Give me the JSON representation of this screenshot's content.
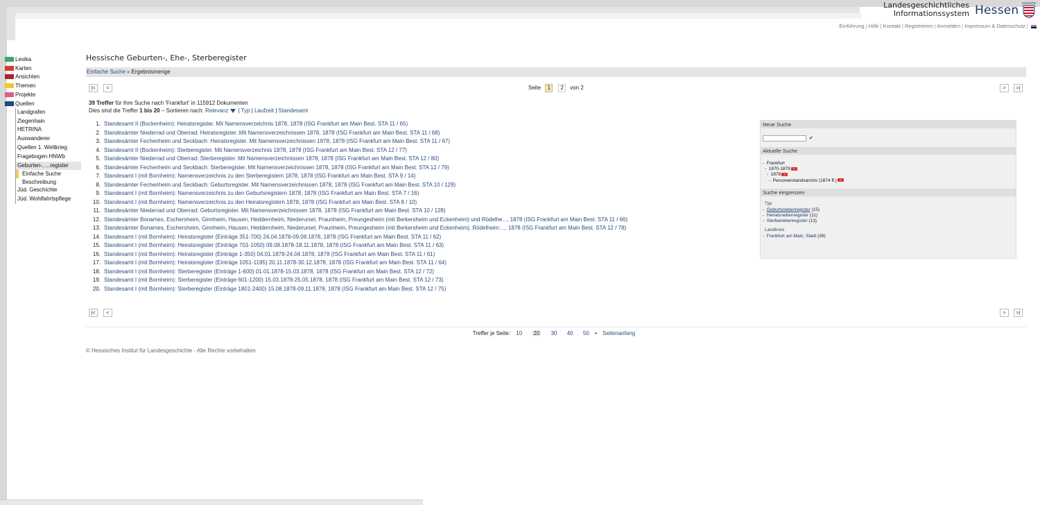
{
  "logo": {
    "line1": "Landesgeschichtliches",
    "line2": "Informationssystem",
    "brand": "Hessen",
    "crest_label": "HESSEN"
  },
  "topnav": [
    "Einführung",
    "Hilfe",
    "Kontakt",
    "Registrieren",
    "Anmelden",
    "Impressum & Datenschutz"
  ],
  "sidebar": {
    "main": [
      {
        "label": "Lexika",
        "color": "#3fa56a"
      },
      {
        "label": "Karten",
        "color": "#d83a2e"
      },
      {
        "label": "Ansichten",
        "color": "#a5282f"
      },
      {
        "label": "Themen",
        "color": "#f2c630"
      },
      {
        "label": "Projekte",
        "color": "#d8608a"
      },
      {
        "label": "Quellen",
        "color": "#1f4a7a"
      }
    ],
    "sub": [
      "Landgrafen",
      "Ziegenhain",
      "HETRINA",
      "Auswanderer",
      "Quellen 1. Weltkrieg",
      "Fragebogen HNWb",
      "Geburten-, ...register",
      "Jüd. Geschichte",
      "Jüd. Wohlfahrtspflege"
    ],
    "subsub": [
      "Einfache Suche",
      "Beschreibung"
    ]
  },
  "page_title": "Hessische Geburten-, Ehe-, Sterberegister",
  "breadcrumb": {
    "link": "Einfache Suche",
    "sep": "»",
    "current": "Ergebnismenge"
  },
  "pager": {
    "first": "|<",
    "prev": "<",
    "next": ">",
    "last": ">|",
    "label": "Seite",
    "pages": [
      "1",
      "2"
    ],
    "of": "von 2"
  },
  "summary": {
    "count": "39 Treffer",
    "text1": "für Ihre Suche nach 'Frankfurt' in 115912 Dokumenten",
    "text2a": "Dies sind die Treffer",
    "range": "1 bis 20",
    "text2b": "– Sortieren nach:",
    "sort": [
      "Relevanz",
      "Typ",
      "Laufzeit",
      "Standesamt"
    ]
  },
  "results": [
    "Standesamt II (Bockenheim): Heiratsregister. Mit Namensverzeichnis 1878, 1878 (ISG Frankfurt am Main Best. STA 11 / 65)",
    "Standesämter Niederrad und Oberrad: Heiratsregister. Mit Namensverzeichnissen 1878, 1878 (ISG Frankfurt am Main Best. STA 11 / 68)",
    "Standesämter Fechenheim und Seckbach: Heiratsregister. Mit Namensverzeichnissen 1878, 1878 (ISG Frankfurt am Main Best. STA 11 / 67)",
    "Standesamt II (Bockenheim): Sterberegister. Mit Namensverzeichnis 1878, 1878 (ISG Frankfurt am Main Best. STA 12 / 77)",
    "Standesämter Niederrad und Oberrad: Sterberegister. Mit Namensverzeichnissen 1878, 1878 (ISG Frankfurt am Main Best. STA 12 / 80)",
    "Standesämter Fechenheim und Seckbach: Sterberegister. Mit Namensverzeichnissen 1878, 1878 (ISG Frankfurt am Main Best. STA 12 / 79)",
    "Standesamt I (mit Bornheim): Namensverzeichnis zu den Sterberegistern 1878, 1878 (ISG Frankfurt am Main Best. STA 9 / 14)",
    "Standesämter Fechenheim und Seckbach: Geburtsregister. Mit Namensverzeichnissen 1878, 1878 (ISG Frankfurt am Main Best. STA 10 / 129)",
    "Standesamt I (mit Bornheim): Namensverzeichnis zu den Geburtsregistern 1878, 1878 (ISG Frankfurt am Main Best. STA 7 / 16)",
    "Standesamt I (mit Bornheim): Namensverzeichnis zu den Heiratsregistern 1878, 1878 (ISG Frankfurt am Main Best. STA 8 / 10)",
    "Standesämter Niederrad und Oberrad: Geburtsregister. Mit Namensverzeichnissen 1878, 1878 (ISG Frankfurt am Main Best. STA 10 / 128)",
    "Standesämter Bonames, Eschersheim, Ginnheim, Hausen, Heddernheim, Niederursel, Praunheim, Preungesheim (mit Berkersheim und Eckenheim) und Rödelhe..., 1878 (ISG Frankfurt am Main Best. STA 11 / 66)",
    "Standesämter Bonames, Eschersheim, Ginnheim, Hausen, Heddernheim, Niederursel, Praunheim, Preungesheim (mit Berkersheim und Eckenheim), Rödelheim:..., 1878 (ISG Frankfurt am Main Best. STA 12 / 78)",
    "Standesamt I (mit Bornheim): Heiratsregister (Einträge 351-700) 24.04.1878-09.08.1878, 1878 (ISG Frankfurt am Main Best. STA 11 / 62)",
    "Standesamt I (mit Bornheim): Heiratsregister (Einträge 701-1050) 09.08.1878-18.11.1878, 1878 (ISG Frankfurt am Main Best. STA 11 / 63)",
    "Standesamt I (mit Bornheim): Heiratsregister (Einträge 1-350) 04.01.1878-24.04.1878, 1878 (ISG Frankfurt am Main Best. STA 11 / 61)",
    "Standesamt I (mit Bornheim): Heiratsregister (Einträge 1051-1195) 20.11.1878-30.12.1878, 1878 (ISG Frankfurt am Main Best. STA 11 / 64)",
    "Standesamt I (mit Bornheim): Sterberegister (Einträge 1-600) 01.01.1878-15.03.1878, 1878 (ISG Frankfurt am Main Best. STA 12 / 72)",
    "Standesamt I (mit Bornheim): Sterberegister (Einträge 601-1200) 15.03.1878-25.05.1878, 1878 (ISG Frankfurt am Main Best. STA 12 / 73)",
    "Standesamt I (mit Bornheim): Sterberegister (Einträge 1801-2400) 15.08.1878-09.11.1878, 1878 (ISG Frankfurt am Main Best. STA 12 / 75)"
  ],
  "panel": {
    "new_search": "Neue Suche",
    "current_search": "Aktuelle Suche",
    "refine": "Suche eingrenzen",
    "tree": [
      "Frankfurt",
      "1870-1879",
      "1878",
      "Personenstandsarchiv (1874 ff.)"
    ],
    "facet_type_label": "Typ",
    "facet_type": [
      {
        "label": "Geburtsnebenregister",
        "count": "(15)"
      },
      {
        "label": "Heiratsnebenregister",
        "count": "(11)"
      },
      {
        "label": "Sterbenebenregister",
        "count": "(13)"
      }
    ],
    "facet_district_label": "Landkreis",
    "facet_district": [
      {
        "label": "Frankfurt am Main, Stadt",
        "count": "(39)"
      }
    ]
  },
  "perpage": {
    "label": "Treffer je Seite:",
    "options": [
      "10",
      "20",
      "30",
      "40",
      "50"
    ],
    "top": "Seitenanfang"
  },
  "copyright": {
    "link": "© Hessisches Institut für Landesgeschichte",
    "text": " - Alle Rechte vorbehalten"
  }
}
